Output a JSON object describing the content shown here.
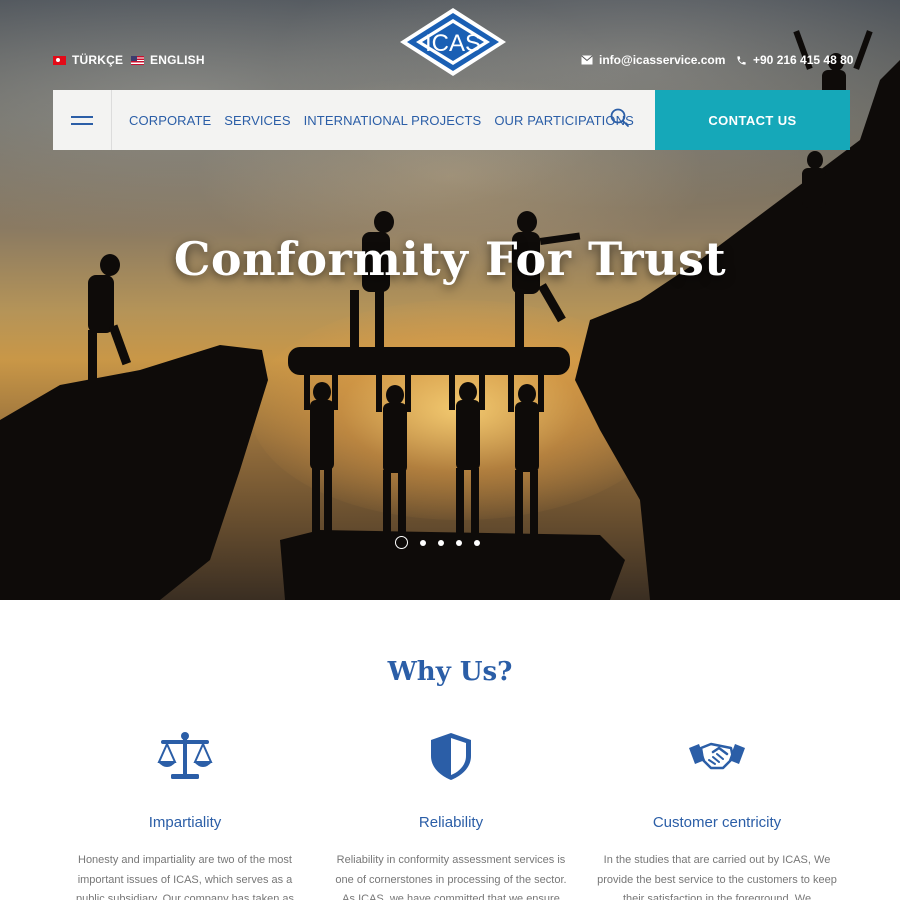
{
  "header": {
    "languages": [
      {
        "label": "TÜRKÇE",
        "flag": "turkey-flag-icon"
      },
      {
        "label": "ENGLISH",
        "flag": "usa-flag-icon"
      }
    ],
    "logo_text": "ICAS",
    "email": "info@icasservice.com",
    "phone": "+90 216 415 48 80"
  },
  "nav": {
    "items": [
      "CORPORATE",
      "SERVICES",
      "INTERNATIONAL PROJECTS",
      "OUR PARTICIPATIONS"
    ],
    "contact_label": "CONTACT US"
  },
  "hero": {
    "title": "Conformity For Trust",
    "slides_count": 5,
    "active_slide": 1
  },
  "why": {
    "title": "Why Us?",
    "features": [
      {
        "icon": "scales-icon",
        "title": "Impartiality",
        "text": "Honesty and impartiality are two of the most important issues of ICAS, which serves as a public subsidiary. Our company has taken as"
      },
      {
        "icon": "shield-icon",
        "title": "Reliability",
        "text": "Reliability in conformity assessment services is one of cornerstones in processing of the sector. As ICAS, we have committed that we ensure"
      },
      {
        "icon": "handshake-icon",
        "title": "Customer centricity",
        "text": "In the studies that are carried out by ICAS, We provide the best service to the customers to keep their satisfaction in the foreground. We"
      }
    ]
  },
  "colors": {
    "brand_blue": "#2b5ea7",
    "accent_teal": "#15a8b9"
  }
}
